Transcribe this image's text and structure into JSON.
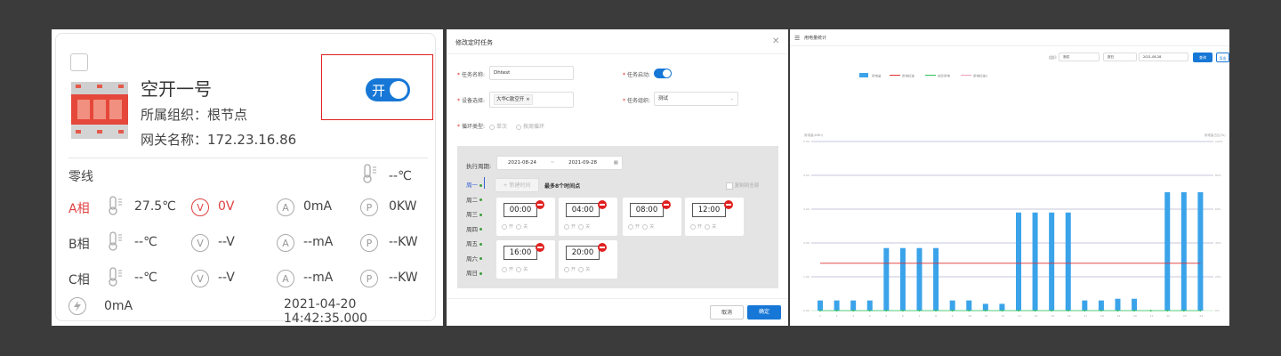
{
  "card": {
    "name": "空开一号",
    "org": "所属组织：根节点",
    "gateway": "网关名称：172.23.16.86",
    "switch_label": "开",
    "neutral_label": "零线",
    "neutral_temp": "--℃",
    "phases": [
      {
        "label": "A相",
        "temp": "27.5℃",
        "voltage": "0V",
        "current": "0mA",
        "power": "0KW",
        "alert": true
      },
      {
        "label": "B相",
        "temp": "--℃",
        "voltage": "--V",
        "current": "--mA",
        "power": "--KW",
        "alert": false
      },
      {
        "label": "C相",
        "temp": "--℃",
        "voltage": "--V",
        "current": "--mA",
        "power": "--KW",
        "alert": false
      }
    ],
    "leak_current": "0mA",
    "timestamp": "2021-04-20 14:42:35.000",
    "icons": {
      "temp": "thermometer-icon",
      "voltage": "V",
      "current": "A",
      "power": "P",
      "leak": "lightning-icon"
    }
  },
  "dialog": {
    "title": "修改定时任务",
    "task_name_label": "任务名称:",
    "task_name_value": "Dhtest",
    "task_enable_label": "任务启动:",
    "device_label": "设备选择:",
    "device_tag": "大华C款空开",
    "task_org_label": "任务组织:",
    "task_org_value": "测试",
    "cycle_label": "循环类型:",
    "cycle_options": [
      "单次",
      "按周循环"
    ],
    "period_label": "执行周期:",
    "date_start": "2021-08-24",
    "date_sep": "~",
    "date_end": "2021-09-28",
    "days": [
      "周一",
      "周二",
      "周三",
      "周四",
      "周五",
      "周六",
      "周日"
    ],
    "add_time_label": "+ 新建时间",
    "max_hint": "最多8个时间点",
    "copy_all_label": "复制到全部",
    "times": [
      "00:00",
      "04:00",
      "08:00",
      "12:00",
      "16:00",
      "20:00"
    ],
    "on_label": "开",
    "off_label": "关",
    "cancel_label": "取消",
    "ok_label": "确定"
  },
  "chart_panel": {
    "title": "用电量统计",
    "filter_label": "组织:",
    "filter_value": "测试",
    "period_value": "按日",
    "date_value": "2021-08-28",
    "query_label": "查询",
    "export_label": "导出",
    "left_axis_label": "用电量(kWh)",
    "right_axis_label": "用电量占比(%)"
  },
  "chart_data": {
    "type": "bar",
    "legend": [
      "用电量",
      "用电标准",
      "实际用电",
      "用电标准2"
    ],
    "categories": [
      "1",
      "2",
      "3",
      "4",
      "5",
      "6",
      "7",
      "8",
      "9",
      "10",
      "11",
      "12",
      "13",
      "14",
      "15",
      "16",
      "17",
      "18",
      "19",
      "20",
      "21",
      "22",
      "23",
      "24"
    ],
    "series": [
      {
        "name": "用电量",
        "values": [
          0.3,
          0.3,
          0.3,
          0.3,
          1.85,
          1.85,
          1.85,
          1.85,
          0.3,
          0.3,
          0.2,
          0.2,
          2.9,
          2.9,
          2.9,
          2.9,
          0.3,
          0.3,
          0.35,
          0.35,
          0,
          3.5,
          3.5,
          3.5
        ]
      },
      {
        "name": "用电标准",
        "values": [
          1.4,
          1.4,
          1.4,
          1.4,
          1.4,
          1.4,
          1.4,
          1.4,
          1.4,
          1.4,
          1.4,
          1.4,
          1.4,
          1.4,
          1.4,
          1.4,
          1.4,
          1.4,
          1.4,
          1.4,
          1.4,
          1.4,
          1.4,
          1.4
        ]
      }
    ],
    "ylim": [
      0,
      5
    ],
    "colors": {
      "bar": "#3aa3ea",
      "line": "#e03030",
      "baseline": "#2ec05a"
    },
    "grid": true,
    "legend_position": "top"
  }
}
